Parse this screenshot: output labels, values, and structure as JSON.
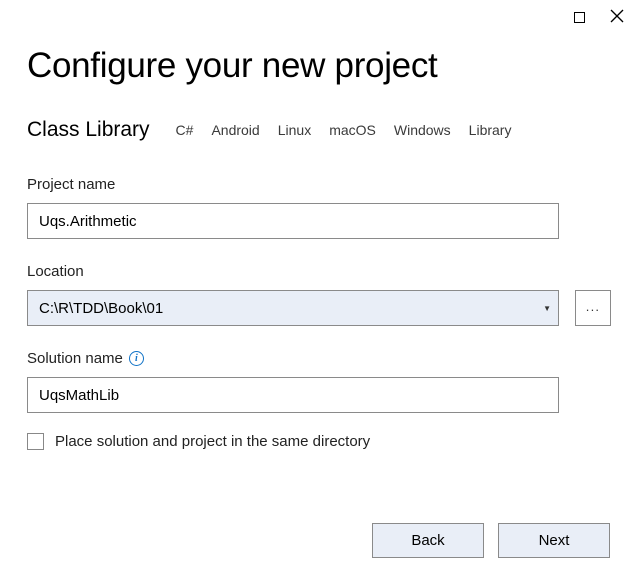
{
  "titlebar": {
    "maximize": "maximize",
    "close": "close"
  },
  "header": {
    "title": "Configure your new project",
    "template_name": "Class Library",
    "tags": [
      "C#",
      "Android",
      "Linux",
      "macOS",
      "Windows",
      "Library"
    ]
  },
  "fields": {
    "project_name": {
      "label": "Project name",
      "value": "Uqs.Arithmetic"
    },
    "location": {
      "label": "Location",
      "value": "C:\\R\\TDD\\Book\\01",
      "browse_label": "..."
    },
    "solution_name": {
      "label": "Solution name",
      "value": "UqsMathLib"
    },
    "same_directory": {
      "label": "Place solution and project in the same directory",
      "checked": false
    }
  },
  "buttons": {
    "back": "Back",
    "next": "Next"
  }
}
